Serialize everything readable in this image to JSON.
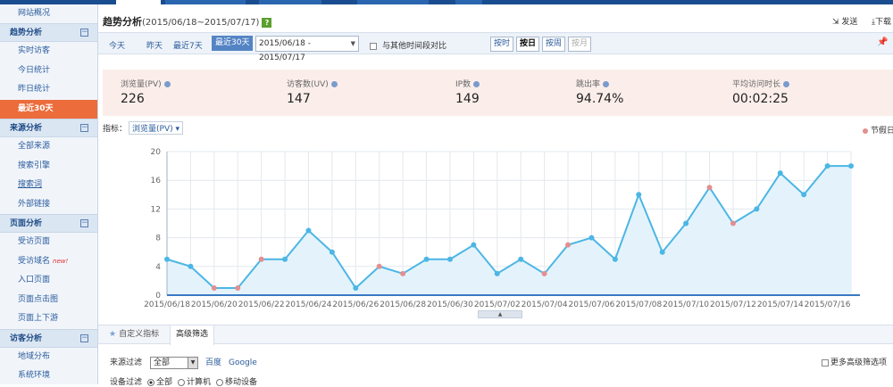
{
  "sidebar": {
    "top_item": "网站概况",
    "groups": [
      {
        "title": "趋势分析",
        "toggle": "⊟",
        "items": [
          "实时访客",
          "今日统计",
          "昨日统计",
          "最近30天"
        ]
      },
      {
        "title": "来源分析",
        "toggle": "⊟",
        "items": [
          "全部来源",
          "搜索引擎",
          "搜索词",
          "外部链接"
        ]
      },
      {
        "title": "页面分析",
        "toggle": "⊟",
        "items": [
          "受访页面",
          "受访域名",
          "入口页面",
          "页面点击图",
          "页面上下游"
        ]
      },
      {
        "title": "访客分析",
        "toggle": "⊟",
        "items": [
          "地域分布",
          "系统环境"
        ]
      }
    ],
    "new_badge": "new!"
  },
  "header": {
    "title": "趋势分析",
    "range": "(2015/06/18~2015/07/17)",
    "help": "?",
    "send_label": "发送",
    "download_label": "下载"
  },
  "filter": {
    "quick": [
      "今天",
      "昨天",
      "最近7天",
      "最近30天"
    ],
    "date_range": "2015/06/18 - 2015/07/17",
    "compare_label": "与其他时间段对比",
    "granularity": [
      "按时",
      "按日",
      "按周",
      "按月"
    ]
  },
  "kpis": [
    {
      "label": "浏览量(PV)",
      "value": "226"
    },
    {
      "label": "访客数(UV)",
      "value": "147"
    },
    {
      "label": "IP数",
      "value": "149"
    },
    {
      "label": "跳出率",
      "value": "94.74%"
    },
    {
      "label": "平均访问时长",
      "value": "00:02:25"
    }
  ],
  "indicator": {
    "label": "指标：",
    "value": "浏览量(PV)"
  },
  "legend_label": "节假日",
  "chart_data": {
    "type": "area",
    "x": [
      "2015/06/18",
      "2015/06/19",
      "2015/06/20",
      "2015/06/21",
      "2015/06/22",
      "2015/06/23",
      "2015/06/24",
      "2015/06/25",
      "2015/06/26",
      "2015/06/27",
      "2015/06/28",
      "2015/06/29",
      "2015/06/30",
      "2015/07/01",
      "2015/07/02",
      "2015/07/03",
      "2015/07/04",
      "2015/07/05",
      "2015/07/06",
      "2015/07/07",
      "2015/07/08",
      "2015/07/09",
      "2015/07/10",
      "2015/07/11",
      "2015/07/12",
      "2015/07/13",
      "2015/07/14",
      "2015/07/15",
      "2015/07/16",
      "2015/07/17"
    ],
    "xticks": [
      "2015/06/18",
      "2015/06/20",
      "2015/06/22",
      "2015/06/24",
      "2015/06/26",
      "2015/06/28",
      "2015/06/30",
      "2015/07/02",
      "2015/07/04",
      "2015/07/06",
      "2015/07/08",
      "2015/07/10",
      "2015/07/12",
      "2015/07/14",
      "2015/07/16"
    ],
    "series": [
      {
        "values": [
          5,
          4,
          1,
          1,
          5,
          5,
          9,
          6,
          1,
          4,
          3,
          5,
          5,
          7,
          3,
          5,
          3,
          7,
          8,
          5,
          14,
          6,
          10,
          15,
          10,
          12,
          17,
          14,
          18,
          18
        ]
      }
    ],
    "holidays": [
      "2015/06/20",
      "2015/06/21",
      "2015/06/22",
      "2015/06/27",
      "2015/06/28",
      "2015/07/04",
      "2015/07/05",
      "2015/07/11",
      "2015/07/12"
    ],
    "ylim": [
      0,
      20
    ],
    "yticks": [
      0,
      4,
      8,
      12,
      16,
      20
    ],
    "grid": true,
    "line_color": "#4cb6e4",
    "fill_color": "#e4f3fb",
    "holiday_color": "#e48f8f"
  },
  "collapse_glyph": "▲",
  "tabs": {
    "custom": "自定义指标",
    "advanced": "高级筛选"
  },
  "filters": {
    "source_label": "来源过滤",
    "source_value": "全部",
    "source_links": [
      "百度",
      "Google"
    ],
    "device_label": "设备过滤",
    "device_options": [
      "全部",
      "计算机",
      "移动设备"
    ],
    "more_label": "更多高级筛选项"
  }
}
